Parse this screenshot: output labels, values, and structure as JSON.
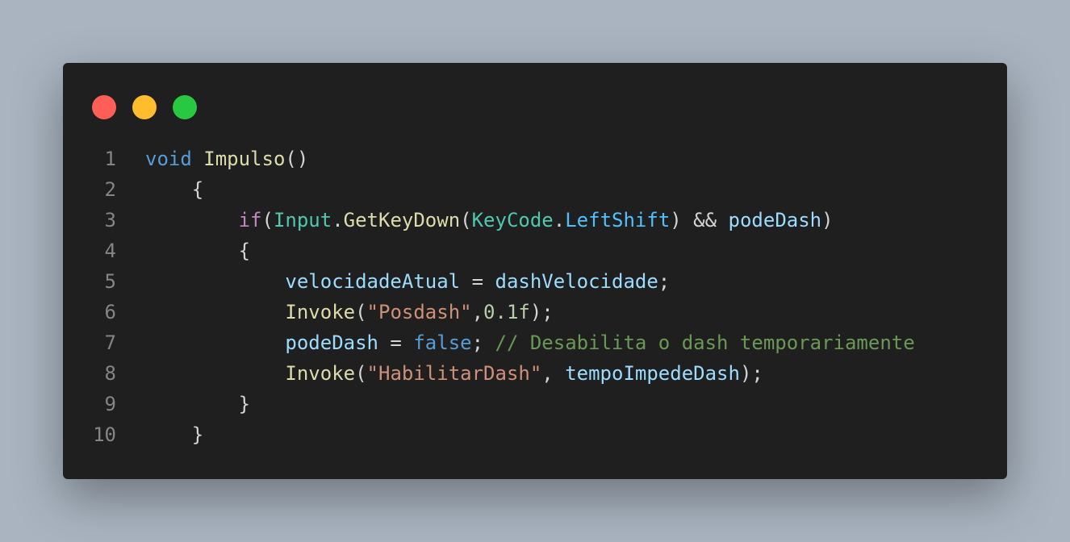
{
  "window": {
    "buttons": [
      {
        "name": "close",
        "color": "#ff5f57"
      },
      {
        "name": "minimize",
        "color": "#ffbd2e"
      },
      {
        "name": "maximize",
        "color": "#28c840"
      }
    ]
  },
  "colors": {
    "background": "#a9b4c0",
    "editor": "#1f1f1f",
    "line_number": "#858585",
    "plain": "#d4d4d4",
    "keyword_blue": "#569cd6",
    "keyword_purple": "#c586c0",
    "function": "#dcdcaa",
    "type": "#4ec9b0",
    "variable": "#9cdcfe",
    "string": "#ce9178",
    "number": "#b5cea8",
    "comment": "#6a9955"
  },
  "code": {
    "lines": [
      {
        "number": "1",
        "indent": "",
        "tokens": [
          {
            "text": "void",
            "color": "#569cd6"
          },
          {
            "text": " ",
            "color": "#d4d4d4"
          },
          {
            "text": "Impulso",
            "color": "#dcdcaa"
          },
          {
            "text": "()",
            "color": "#d4d4d4"
          }
        ]
      },
      {
        "number": "2",
        "indent": "    ",
        "tokens": [
          {
            "text": "{",
            "color": "#d4d4d4"
          }
        ]
      },
      {
        "number": "3",
        "indent": "        ",
        "tokens": [
          {
            "text": "if",
            "color": "#c586c0"
          },
          {
            "text": "(",
            "color": "#d4d4d4"
          },
          {
            "text": "Input",
            "color": "#4ec9b0"
          },
          {
            "text": ".",
            "color": "#d4d4d4"
          },
          {
            "text": "GetKeyDown",
            "color": "#dcdcaa"
          },
          {
            "text": "(",
            "color": "#d4d4d4"
          },
          {
            "text": "KeyCode",
            "color": "#4ec9b0"
          },
          {
            "text": ".",
            "color": "#d4d4d4"
          },
          {
            "text": "LeftShift",
            "color": "#4fc1ff"
          },
          {
            "text": ") && ",
            "color": "#d4d4d4"
          },
          {
            "text": "podeDash",
            "color": "#9cdcfe"
          },
          {
            "text": ")",
            "color": "#d4d4d4"
          }
        ]
      },
      {
        "number": "4",
        "indent": "        ",
        "tokens": [
          {
            "text": "{",
            "color": "#d4d4d4"
          }
        ]
      },
      {
        "number": "5",
        "indent": "            ",
        "tokens": [
          {
            "text": "velocidadeAtual",
            "color": "#9cdcfe"
          },
          {
            "text": " = ",
            "color": "#d4d4d4"
          },
          {
            "text": "dashVelocidade",
            "color": "#9cdcfe"
          },
          {
            "text": ";",
            "color": "#d4d4d4"
          }
        ]
      },
      {
        "number": "6",
        "indent": "            ",
        "tokens": [
          {
            "text": "Invoke",
            "color": "#dcdcaa"
          },
          {
            "text": "(",
            "color": "#d4d4d4"
          },
          {
            "text": "\"Posdash\"",
            "color": "#ce9178"
          },
          {
            "text": ",",
            "color": "#d4d4d4"
          },
          {
            "text": "0.1f",
            "color": "#b5cea8"
          },
          {
            "text": ");",
            "color": "#d4d4d4"
          }
        ]
      },
      {
        "number": "7",
        "indent": "            ",
        "tokens": [
          {
            "text": "podeDash",
            "color": "#9cdcfe"
          },
          {
            "text": " = ",
            "color": "#d4d4d4"
          },
          {
            "text": "false",
            "color": "#569cd6"
          },
          {
            "text": "; ",
            "color": "#d4d4d4"
          },
          {
            "text": "// Desabilita o dash temporariamente",
            "color": "#6a9955"
          }
        ]
      },
      {
        "number": "8",
        "indent": "            ",
        "tokens": [
          {
            "text": "Invoke",
            "color": "#dcdcaa"
          },
          {
            "text": "(",
            "color": "#d4d4d4"
          },
          {
            "text": "\"HabilitarDash\"",
            "color": "#ce9178"
          },
          {
            "text": ", ",
            "color": "#d4d4d4"
          },
          {
            "text": "tempoImpedeDash",
            "color": "#9cdcfe"
          },
          {
            "text": ");",
            "color": "#d4d4d4"
          }
        ]
      },
      {
        "number": "9",
        "indent": "        ",
        "tokens": [
          {
            "text": "}",
            "color": "#d4d4d4"
          }
        ]
      },
      {
        "number": "10",
        "indent": "    ",
        "tokens": [
          {
            "text": "}",
            "color": "#d4d4d4"
          }
        ]
      }
    ]
  }
}
